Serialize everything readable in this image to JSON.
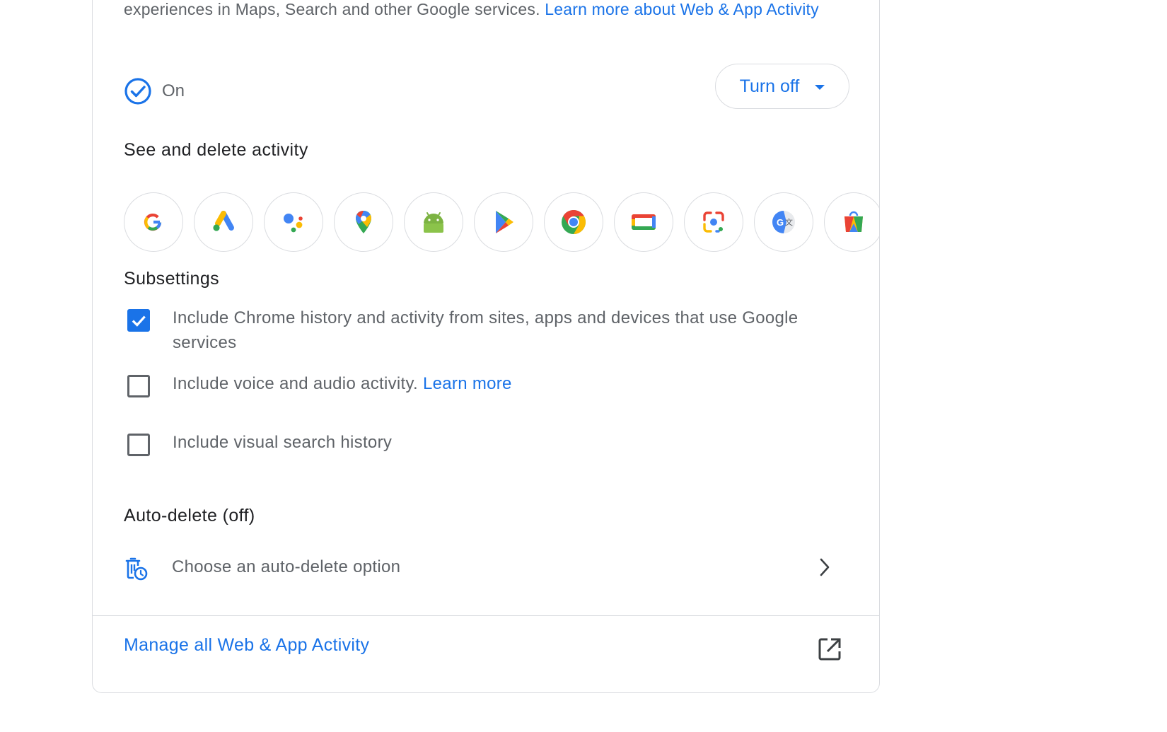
{
  "intro": {
    "text": "experiences in Maps, Search and other Google services. ",
    "link": "Learn more about Web & App Activity"
  },
  "status": {
    "label": "On",
    "button_label": "Turn off"
  },
  "see_delete": {
    "title": "See and delete activity",
    "apps": [
      "google-search-icon",
      "google-ads-icon",
      "google-assistant-icon",
      "google-maps-icon",
      "android-icon",
      "google-play-icon",
      "chrome-icon",
      "google-tv-icon",
      "google-lens-icon",
      "google-translate-icon",
      "google-shopping-icon"
    ]
  },
  "subsettings": {
    "title": "Subsettings",
    "items": [
      {
        "text": "Include Chrome history and activity from sites, apps and devices that use Google services",
        "checked": true
      },
      {
        "text": "Include voice and audio activity. ",
        "link": "Learn more",
        "checked": false
      },
      {
        "text": "Include visual search history",
        "checked": false
      }
    ]
  },
  "auto_delete": {
    "title": "Auto-delete (off)",
    "option": "Choose an auto-delete option"
  },
  "footer": {
    "manage_link": "Manage all Web & App Activity"
  },
  "colors": {
    "accent": "#1a73e8",
    "text_secondary": "#5f6368",
    "border": "#dadce0"
  }
}
